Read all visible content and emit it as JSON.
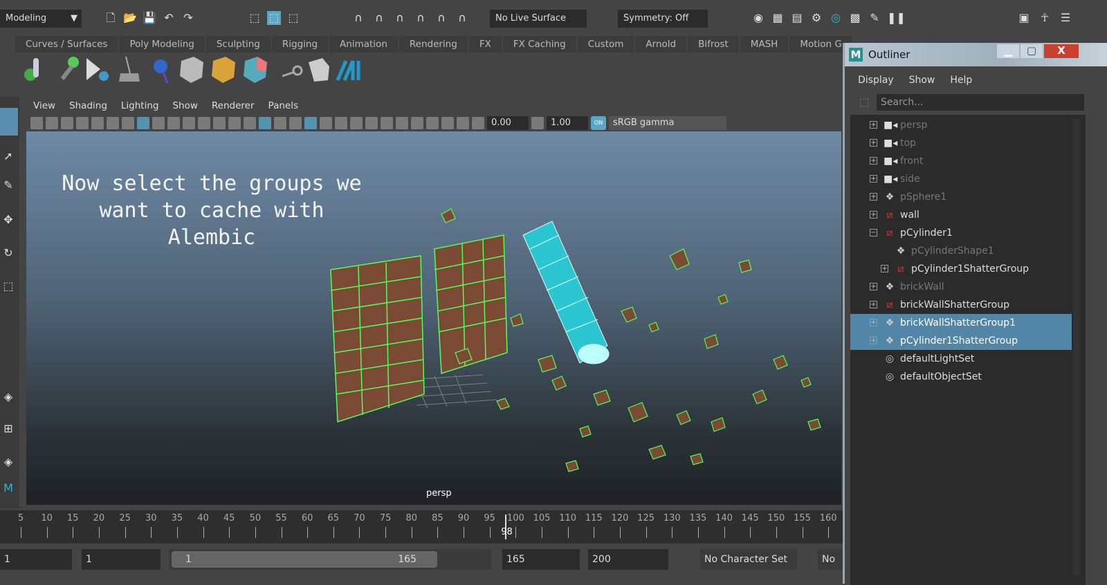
{
  "topbar": {
    "workspace": "Modeling",
    "live_surface": "No Live Surface",
    "symmetry": "Symmetry: Off"
  },
  "shelf_tabs": [
    "Curves / Surfaces",
    "Poly Modeling",
    "Sculpting",
    "Rigging",
    "Animation",
    "Rendering",
    "FX",
    "FX Caching",
    "Custom",
    "Arnold",
    "Bifrost",
    "MASH",
    "Motion G"
  ],
  "panel_menu": [
    "View",
    "Shading",
    "Lighting",
    "Show",
    "Renderer",
    "Panels"
  ],
  "viewport": {
    "exposure": "0.00",
    "gamma": "1.00",
    "color_mgmt_toggle": "ON",
    "color_space": "sRGB gamma",
    "camera": "persp",
    "caption": "Now select the groups we\nwant to cache with\nAlembic"
  },
  "timeline": {
    "ticks": [
      5,
      10,
      15,
      20,
      25,
      30,
      35,
      40,
      45,
      50,
      55,
      60,
      65,
      70,
      75,
      80,
      85,
      90,
      95,
      100,
      105,
      110,
      115,
      120,
      125,
      130,
      135,
      140,
      145,
      150,
      155,
      160
    ],
    "current_frame": "98"
  },
  "range": {
    "start": "1",
    "playback_start": "1",
    "slider_start": "1",
    "slider_end": "165",
    "playback_end": "165",
    "end": "200",
    "character_set": "No Character Set",
    "anim_layer": "No"
  },
  "outliner": {
    "title": "Outliner",
    "menu": [
      "Display",
      "Show",
      "Help"
    ],
    "search_placeholder": "Search...",
    "items": [
      {
        "name": "persp",
        "icon": "camera",
        "dim": true,
        "selected": false,
        "exp": "+",
        "indent": 0
      },
      {
        "name": "top",
        "icon": "camera",
        "dim": true,
        "selected": false,
        "exp": "+",
        "indent": 0
      },
      {
        "name": "front",
        "icon": "camera",
        "dim": true,
        "selected": false,
        "exp": "+",
        "indent": 0
      },
      {
        "name": "side",
        "icon": "camera",
        "dim": true,
        "selected": false,
        "exp": "+",
        "indent": 0
      },
      {
        "name": "pSphere1",
        "icon": "mesh",
        "dim": true,
        "selected": false,
        "exp": "+",
        "indent": 0
      },
      {
        "name": "wall",
        "icon": "group",
        "dim": false,
        "selected": false,
        "exp": "+",
        "indent": 0
      },
      {
        "name": "pCylinder1",
        "icon": "group",
        "dim": false,
        "selected": false,
        "exp": "-",
        "indent": 0
      },
      {
        "name": "pCylinderShape1",
        "icon": "mesh",
        "dim": true,
        "selected": false,
        "exp": "",
        "indent": 1
      },
      {
        "name": "pCylinder1ShatterGroup",
        "icon": "group",
        "dim": false,
        "selected": false,
        "exp": "+",
        "indent": 1
      },
      {
        "name": "brickWall",
        "icon": "mesh",
        "dim": true,
        "selected": false,
        "exp": "+",
        "indent": 0
      },
      {
        "name": "brickWallShatterGroup",
        "icon": "group",
        "dim": false,
        "selected": false,
        "exp": "+",
        "indent": 0
      },
      {
        "name": "brickWallShatterGroup1",
        "icon": "mesh",
        "dim": false,
        "selected": true,
        "exp": "+",
        "indent": 0
      },
      {
        "name": "pCylinder1ShatterGroup",
        "icon": "mesh",
        "dim": false,
        "selected": true,
        "exp": "+",
        "indent": 0
      },
      {
        "name": "defaultLightSet",
        "icon": "set",
        "dim": false,
        "selected": false,
        "exp": "",
        "indent": 0
      },
      {
        "name": "defaultObjectSet",
        "icon": "set",
        "dim": false,
        "selected": false,
        "exp": "",
        "indent": 0
      }
    ]
  }
}
